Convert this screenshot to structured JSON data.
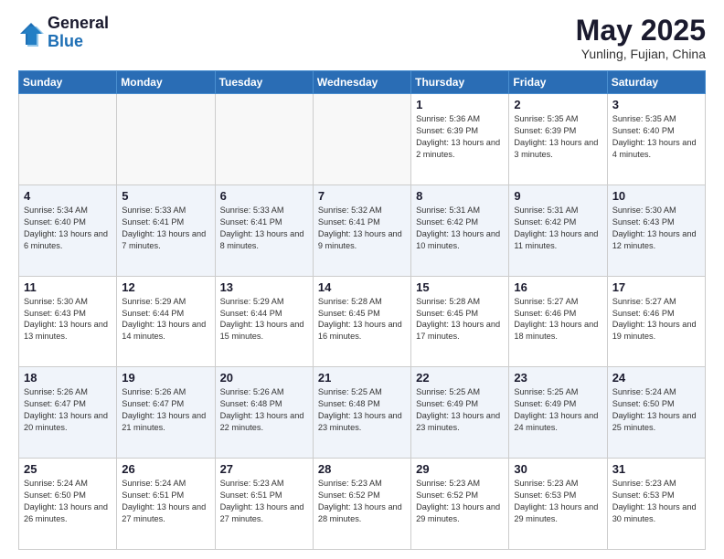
{
  "header": {
    "logo": {
      "general": "General",
      "blue": "Blue"
    },
    "title": "May 2025",
    "subtitle": "Yunling, Fujian, China"
  },
  "weekdays": [
    "Sunday",
    "Monday",
    "Tuesday",
    "Wednesday",
    "Thursday",
    "Friday",
    "Saturday"
  ],
  "weeks": [
    [
      {
        "day": "",
        "empty": true
      },
      {
        "day": "",
        "empty": true
      },
      {
        "day": "",
        "empty": true
      },
      {
        "day": "",
        "empty": true
      },
      {
        "day": "1",
        "sunrise": "5:36 AM",
        "sunset": "6:39 PM",
        "daylight": "13 hours and 2 minutes."
      },
      {
        "day": "2",
        "sunrise": "5:35 AM",
        "sunset": "6:39 PM",
        "daylight": "13 hours and 3 minutes."
      },
      {
        "day": "3",
        "sunrise": "5:35 AM",
        "sunset": "6:40 PM",
        "daylight": "13 hours and 4 minutes."
      }
    ],
    [
      {
        "day": "4",
        "sunrise": "5:34 AM",
        "sunset": "6:40 PM",
        "daylight": "13 hours and 6 minutes."
      },
      {
        "day": "5",
        "sunrise": "5:33 AM",
        "sunset": "6:41 PM",
        "daylight": "13 hours and 7 minutes."
      },
      {
        "day": "6",
        "sunrise": "5:33 AM",
        "sunset": "6:41 PM",
        "daylight": "13 hours and 8 minutes."
      },
      {
        "day": "7",
        "sunrise": "5:32 AM",
        "sunset": "6:41 PM",
        "daylight": "13 hours and 9 minutes."
      },
      {
        "day": "8",
        "sunrise": "5:31 AM",
        "sunset": "6:42 PM",
        "daylight": "13 hours and 10 minutes."
      },
      {
        "day": "9",
        "sunrise": "5:31 AM",
        "sunset": "6:42 PM",
        "daylight": "13 hours and 11 minutes."
      },
      {
        "day": "10",
        "sunrise": "5:30 AM",
        "sunset": "6:43 PM",
        "daylight": "13 hours and 12 minutes."
      }
    ],
    [
      {
        "day": "11",
        "sunrise": "5:30 AM",
        "sunset": "6:43 PM",
        "daylight": "13 hours and 13 minutes."
      },
      {
        "day": "12",
        "sunrise": "5:29 AM",
        "sunset": "6:44 PM",
        "daylight": "13 hours and 14 minutes."
      },
      {
        "day": "13",
        "sunrise": "5:29 AM",
        "sunset": "6:44 PM",
        "daylight": "13 hours and 15 minutes."
      },
      {
        "day": "14",
        "sunrise": "5:28 AM",
        "sunset": "6:45 PM",
        "daylight": "13 hours and 16 minutes."
      },
      {
        "day": "15",
        "sunrise": "5:28 AM",
        "sunset": "6:45 PM",
        "daylight": "13 hours and 17 minutes."
      },
      {
        "day": "16",
        "sunrise": "5:27 AM",
        "sunset": "6:46 PM",
        "daylight": "13 hours and 18 minutes."
      },
      {
        "day": "17",
        "sunrise": "5:27 AM",
        "sunset": "6:46 PM",
        "daylight": "13 hours and 19 minutes."
      }
    ],
    [
      {
        "day": "18",
        "sunrise": "5:26 AM",
        "sunset": "6:47 PM",
        "daylight": "13 hours and 20 minutes."
      },
      {
        "day": "19",
        "sunrise": "5:26 AM",
        "sunset": "6:47 PM",
        "daylight": "13 hours and 21 minutes."
      },
      {
        "day": "20",
        "sunrise": "5:26 AM",
        "sunset": "6:48 PM",
        "daylight": "13 hours and 22 minutes."
      },
      {
        "day": "21",
        "sunrise": "5:25 AM",
        "sunset": "6:48 PM",
        "daylight": "13 hours and 23 minutes."
      },
      {
        "day": "22",
        "sunrise": "5:25 AM",
        "sunset": "6:49 PM",
        "daylight": "13 hours and 23 minutes."
      },
      {
        "day": "23",
        "sunrise": "5:25 AM",
        "sunset": "6:49 PM",
        "daylight": "13 hours and 24 minutes."
      },
      {
        "day": "24",
        "sunrise": "5:24 AM",
        "sunset": "6:50 PM",
        "daylight": "13 hours and 25 minutes."
      }
    ],
    [
      {
        "day": "25",
        "sunrise": "5:24 AM",
        "sunset": "6:50 PM",
        "daylight": "13 hours and 26 minutes."
      },
      {
        "day": "26",
        "sunrise": "5:24 AM",
        "sunset": "6:51 PM",
        "daylight": "13 hours and 27 minutes."
      },
      {
        "day": "27",
        "sunrise": "5:23 AM",
        "sunset": "6:51 PM",
        "daylight": "13 hours and 27 minutes."
      },
      {
        "day": "28",
        "sunrise": "5:23 AM",
        "sunset": "6:52 PM",
        "daylight": "13 hours and 28 minutes."
      },
      {
        "day": "29",
        "sunrise": "5:23 AM",
        "sunset": "6:52 PM",
        "daylight": "13 hours and 29 minutes."
      },
      {
        "day": "30",
        "sunrise": "5:23 AM",
        "sunset": "6:53 PM",
        "daylight": "13 hours and 29 minutes."
      },
      {
        "day": "31",
        "sunrise": "5:23 AM",
        "sunset": "6:53 PM",
        "daylight": "13 hours and 30 minutes."
      }
    ]
  ]
}
